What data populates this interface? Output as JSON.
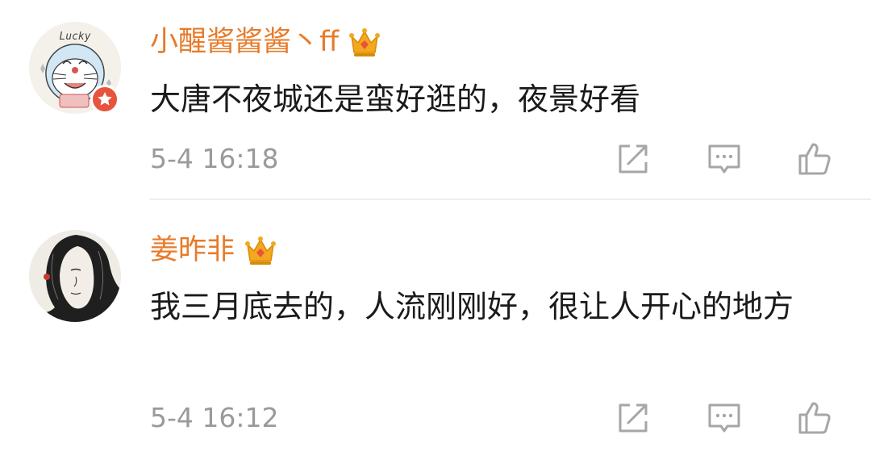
{
  "colors": {
    "username": "#e77b2a",
    "comment_text": "#1a1a1a",
    "timestamp": "#9a9a9a",
    "icon": "#a6a6a6",
    "divider": "#eeeeee",
    "verified_badge": "#e8533d"
  },
  "comments": [
    {
      "avatar_icon": "cartoon-cat-avatar",
      "avatar_text": "Lucky",
      "verified_badge_icon": "star-badge-icon",
      "username": "小醒酱酱酱丶ff",
      "badge_icon": "crown-icon",
      "text": "大唐不夜城还是蛮好逛的，夜景好看",
      "time": "5-4 16:18",
      "actions": [
        "share-icon",
        "reply-icon",
        "like-icon"
      ]
    },
    {
      "avatar_icon": "ink-portrait-avatar",
      "username": "姜昨非",
      "badge_icon": "crown-icon",
      "text": "我三月底去的，人流刚刚好，很让人开心的地方",
      "time": "5-4 16:12",
      "actions": [
        "share-icon",
        "reply-icon",
        "like-icon"
      ]
    }
  ]
}
